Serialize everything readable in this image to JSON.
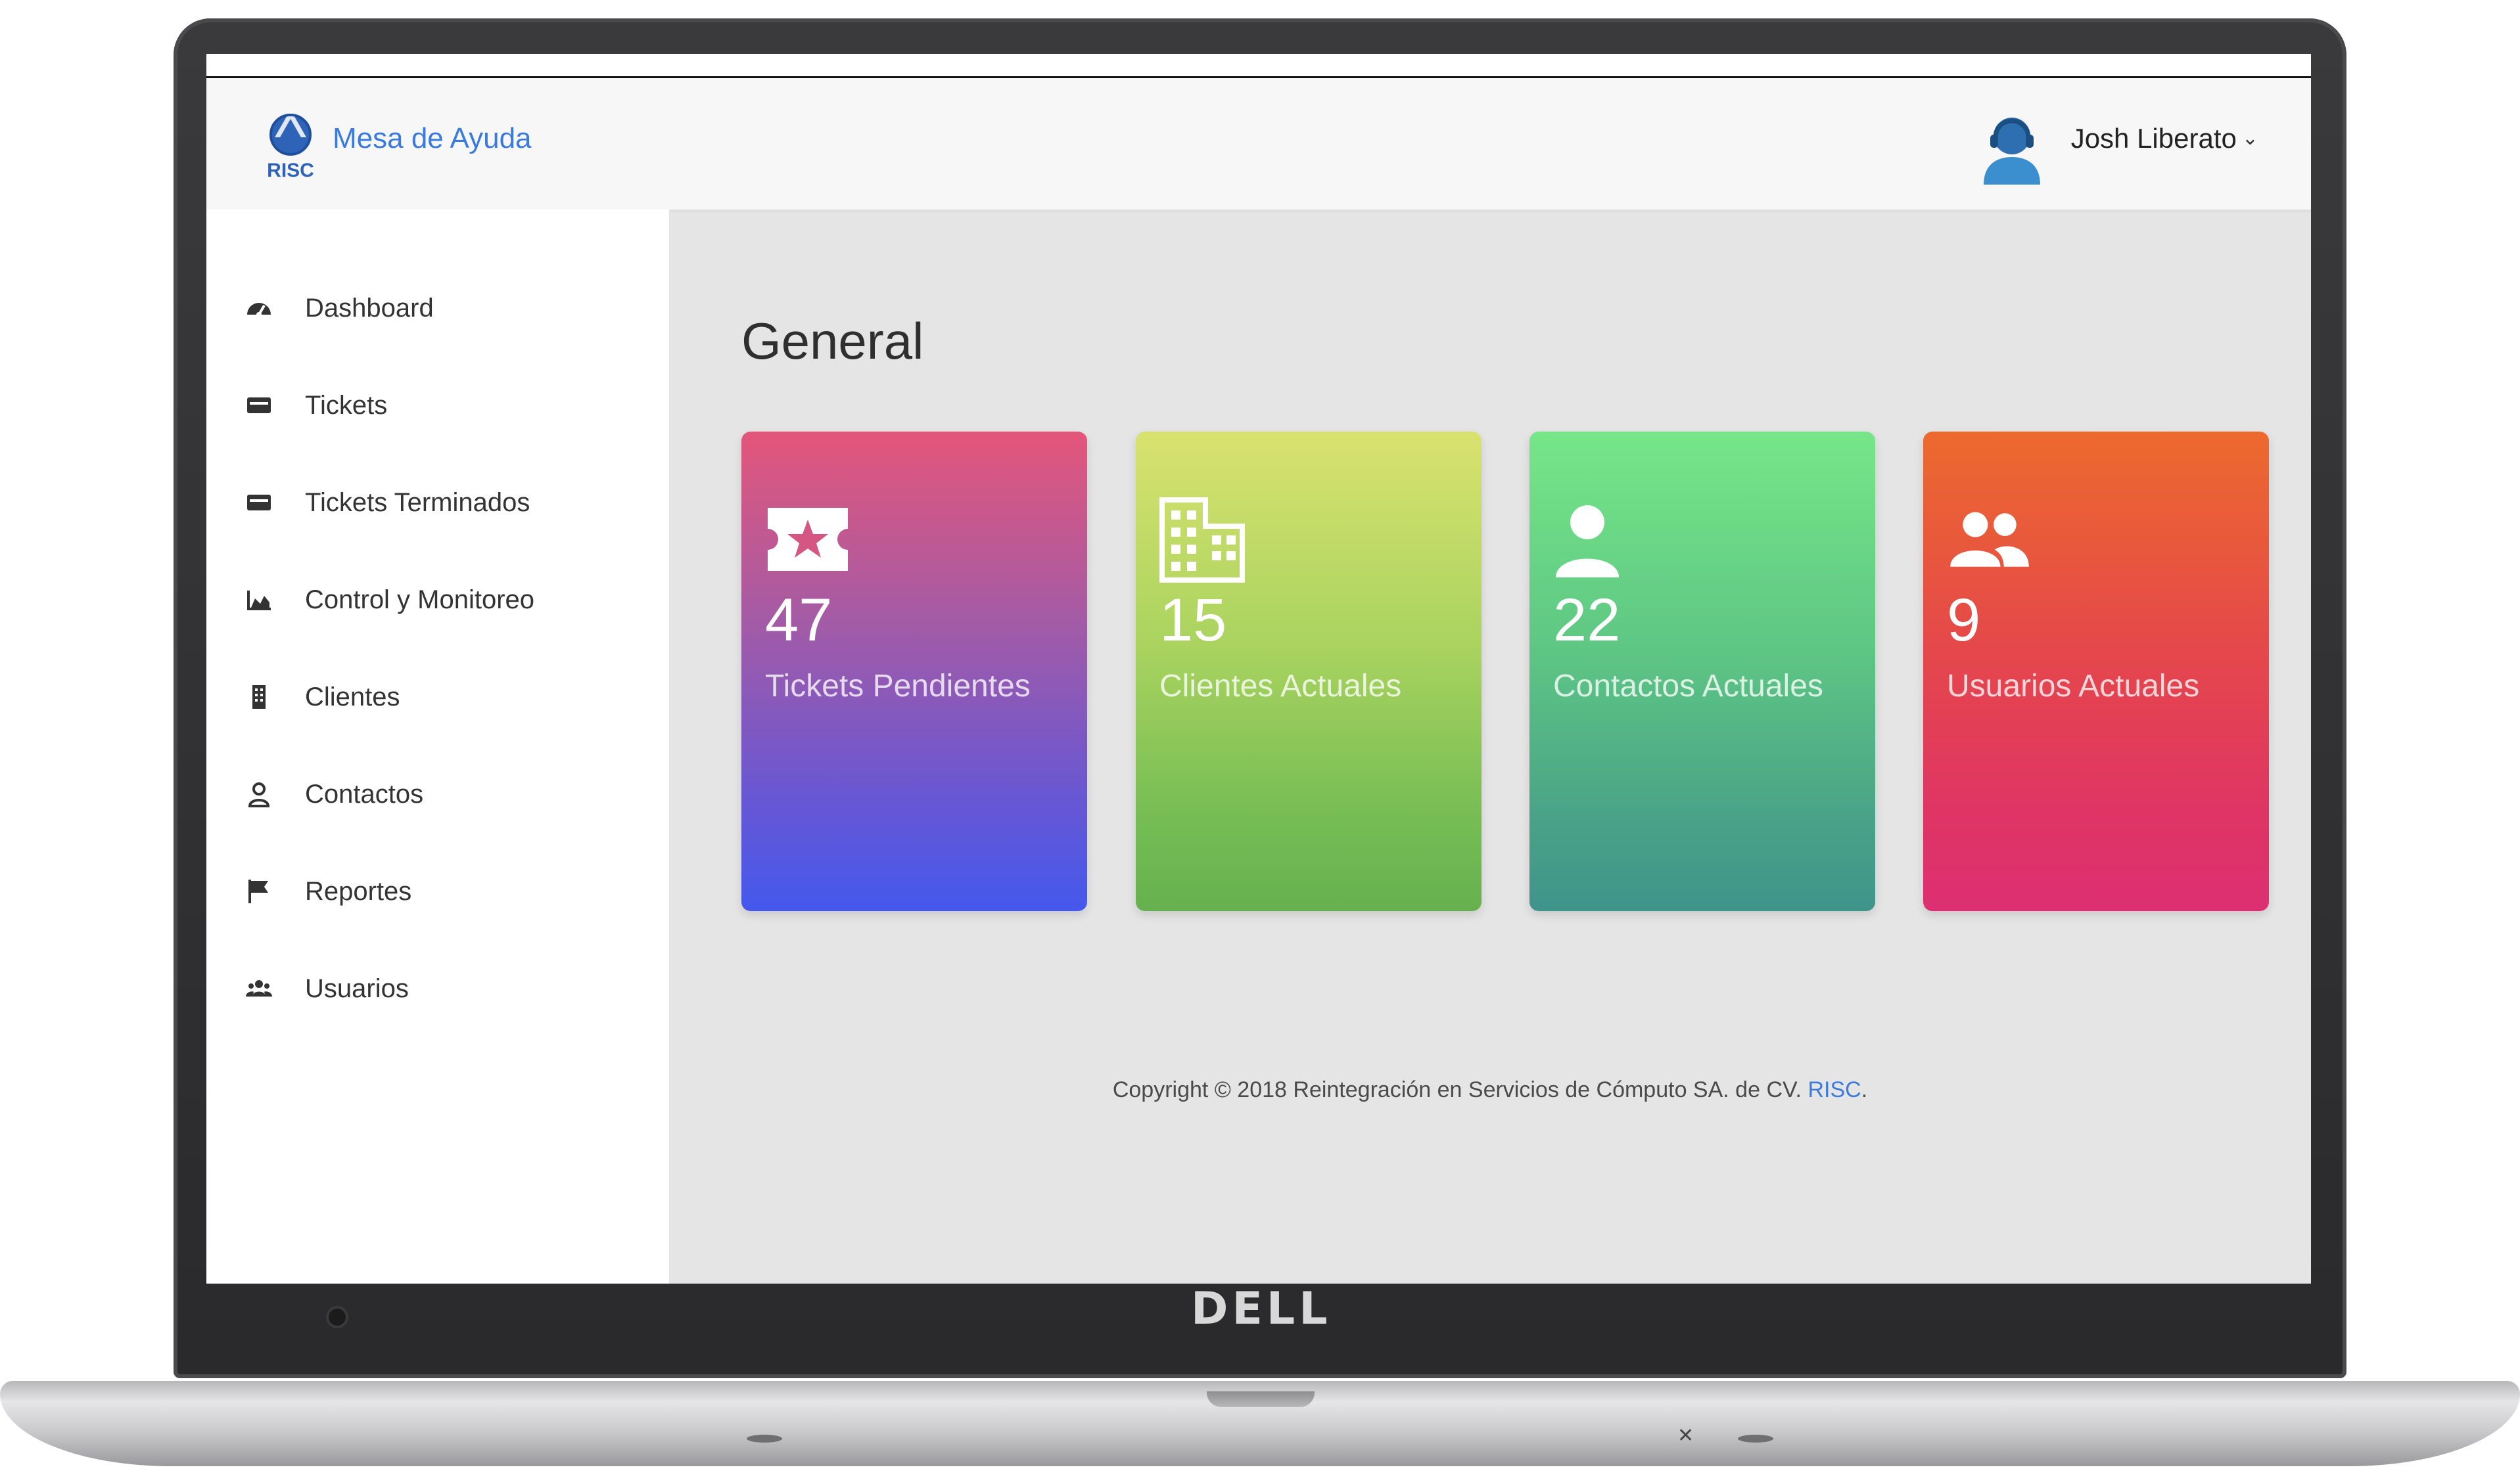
{
  "device": {
    "brand": "DELL"
  },
  "app": {
    "brand_title": "Mesa de Ayuda",
    "logo_text": "RISC"
  },
  "header": {
    "user_name": "Josh Liberato",
    "chevron": "⌄"
  },
  "sidebar": {
    "items": [
      {
        "label": "Dashboard",
        "icon": "dashboard-icon"
      },
      {
        "label": "Tickets",
        "icon": "ticket-icon"
      },
      {
        "label": "Tickets Terminados",
        "icon": "ticket-done-icon"
      },
      {
        "label": "Control y Monitoreo",
        "icon": "area-chart-icon"
      },
      {
        "label": "Clientes",
        "icon": "building-icon"
      },
      {
        "label": "Contactos",
        "icon": "user-outline-icon"
      },
      {
        "label": "Reportes",
        "icon": "flag-icon"
      },
      {
        "label": "Usuarios",
        "icon": "users-icon"
      }
    ]
  },
  "main": {
    "title": "General",
    "cards": [
      {
        "value": "47",
        "label": "Tickets Pendientes",
        "icon": "ticket-star-icon"
      },
      {
        "value": "15",
        "label": "Clientes Actuales",
        "icon": "building-icon"
      },
      {
        "value": "22",
        "label": "Contactos Actuales",
        "icon": "user-icon"
      },
      {
        "value": "9",
        "label": "Usuarios Actuales",
        "icon": "users-icon"
      }
    ]
  },
  "footer": {
    "text": "Copyright © 2018 Reintegración en Servicios de Cómputo SA. de CV. ",
    "link_text": "RISC",
    "trailing": "."
  },
  "colors": {
    "accent": "#3b7be0",
    "sidebar_bg": "#ffffff",
    "content_bg": "#e5e5e5"
  }
}
